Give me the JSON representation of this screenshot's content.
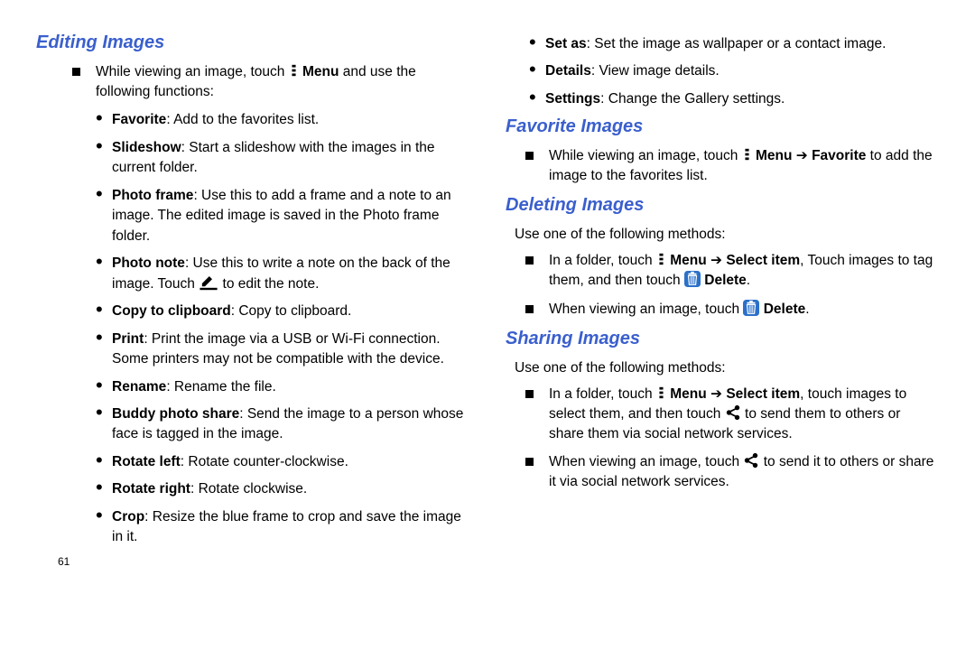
{
  "page_number": "61",
  "left": {
    "heading1": "Editing Images",
    "intro_pre": "While viewing an image, touch ",
    "intro_bold": "Menu",
    "intro_post": " and use the following functions:",
    "items": {
      "favorite": {
        "label": "Favorite",
        "desc": ": Add to the favorites list."
      },
      "slideshow": {
        "label": "Slideshow",
        "desc": ": Start a slideshow with the images in the current folder."
      },
      "photoframe": {
        "label": "Photo frame",
        "desc": ": Use this to add a frame and a note to an image. The edited image is saved in the Photo frame folder."
      },
      "photonote": {
        "label": "Photo note",
        "desc_pre": ": Use this to write a note on the back of the image. Touch ",
        "desc_post": " to edit the note."
      },
      "copy": {
        "label": "Copy to clipboard",
        "desc": ": Copy to clipboard."
      },
      "print": {
        "label": "Print",
        "desc": ": Print the image via a USB or Wi-Fi connection. Some printers may not be compatible with the device."
      },
      "rename": {
        "label": "Rename",
        "desc": ": Rename the file."
      },
      "buddy": {
        "label": "Buddy photo share",
        "desc": ": Send the image to a person whose face is tagged in the image."
      },
      "rotleft": {
        "label": "Rotate left",
        "desc": ": Rotate counter-clockwise."
      },
      "rotright": {
        "label": "Rotate right",
        "desc": ": Rotate clockwise."
      },
      "crop": {
        "label": "Crop",
        "desc": ": Resize the blue frame to crop and save the image in it."
      }
    }
  },
  "right": {
    "cont_items": {
      "setas": {
        "label": "Set as",
        "desc": ": Set the image as wallpaper or a contact image."
      },
      "details": {
        "label": "Details",
        "desc": ": View image details."
      },
      "settings": {
        "label": "Settings",
        "desc": ": Change the Gallery settings."
      }
    },
    "favheading": "Favorite Images",
    "fav_pre": "While viewing an image, touch ",
    "fav_b1": "Menu",
    "fav_arrow": " ➔ ",
    "fav_b2": "Favorite",
    "fav_post": " to add the image to the favorites list.",
    "delheading": "Deleting Images",
    "del_intro": "Use one of the following methods:",
    "del1_pre": "In a folder, touch ",
    "del1_b1": "Menu",
    "del1_arrow": " ➔ ",
    "del1_b2": "Select item",
    "del1_mid": ", Touch images to tag them, and then touch ",
    "del1_b3": "Delete",
    "del1_end": ".",
    "del2_pre": "When viewing an image, touch ",
    "del2_b1": "Delete",
    "del2_end": ".",
    "shareheading": "Sharing Images",
    "share_intro": "Use one of the following methods:",
    "sh1_pre": "In a folder, touch ",
    "sh1_b1": "Menu",
    "sh1_arrow": " ➔ ",
    "sh1_b2": "Select item",
    "sh1_mid": ", touch images to select them, and then touch ",
    "sh1_post": " to send them to others or share them via social network services.",
    "sh2_pre": "When viewing an image, touch ",
    "sh2_post": " to send it to others or share it via social network services."
  }
}
